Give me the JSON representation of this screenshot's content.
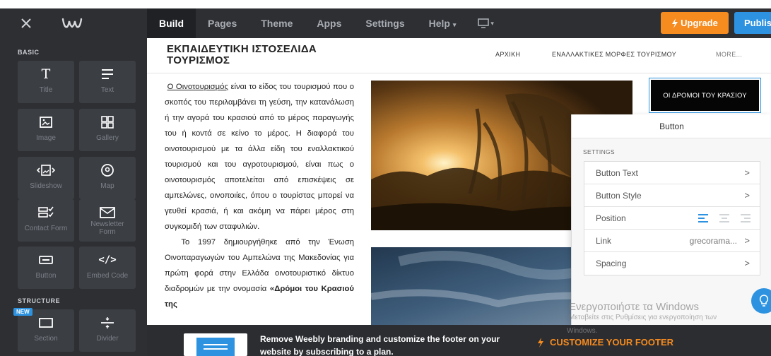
{
  "topbar": {
    "tabs": [
      "Build",
      "Pages",
      "Theme",
      "Apps",
      "Settings",
      "Help"
    ],
    "help_caret": "▾",
    "device_caret": "▾",
    "upgrade_label": "Upgrade",
    "publish_label": "Publish",
    "accent_orange": "#f68b1f",
    "accent_blue": "#2d93e1"
  },
  "sidebar": {
    "basic_heading": "BASIC",
    "structure_heading": "STRUCTURE",
    "new_badge": "NEW",
    "basic_items": [
      "Title",
      "Text",
      "Image",
      "Gallery",
      "Slideshow",
      "Map",
      "Contact Form",
      "Newsletter Form",
      "Button",
      "Embed Code"
    ],
    "newsletter_line1": "Newsletter",
    "newsletter_line2": "Form",
    "embed_icon_glyph": "</>",
    "title_icon_glyph": "T",
    "structure_items": [
      "Section",
      "Divider"
    ]
  },
  "site": {
    "title_line1": "ΕΚΠΑΙΔΕΥΤΙΚΗ ΙΣΤΟΣΕΛΙΔΑ",
    "title_line2": "ΤΟΥΡΙΣΜΟΣ",
    "nav": [
      "ΑΡΧΙΚΗ",
      "ΕΝΑΛΛΑΚΤΙΚΕΣ ΜΟΡΦΕΣ ΤΟΥΡΙΣΜΟΥ",
      "MORE..."
    ]
  },
  "article": {
    "link_text": "Ο Οινοτουρισμός",
    "para1_rest": " είναι το είδος του τουρισμού που ο σκοπός του περιλαμβάνει τη γεύση, την κατανάλωση ή την αγορά του κρασιού από το μέρος παραγωγής του ή κοντά σε κείνο το μέρος. Η διαφορά του οινοτουρισμού με τα άλλα είδη του εναλλακτικού τουρισμού και του αγροτουρισμού, είναι πως ο οινοτουρισμός αποτελείται από επισκέψεις σε αμπελώνες, οινοποιίες, όπου ο τουρίστας μπορεί να γευθεί κρασιά, ή και ακόμη να πάρει μέρος στη συγκομιδή των σταφυλιών.",
    "para2": "Το 1997 δημιουργήθηκε από την Ένωση Οινοπαραγωγών του Αμπελώνα της Μακεδονίας για πρώτη φορά στην Ελλάδα οινοτουριστικό δίκτυο διαδρομών με την ονομασία",
    "para2_bold": "«Δρόμοι του Κρασιού της"
  },
  "button_element": {
    "label": "ΟΙ ΔΡΟΜΟΙ ΤΟΥ ΚΡΑΣΙΟΥ"
  },
  "panel": {
    "title": "Button",
    "caption": "SETTINGS",
    "rows": [
      "Button Text",
      "Button Style",
      "Position",
      "Link",
      "Spacing"
    ],
    "link_value": "grecorama...",
    "chevron": ">"
  },
  "watermark": {
    "line1": "Ενεργοποιήστε τα Windows",
    "line2": "Μεταβείτε στις Ρυθμίσεις για ενεργοποίηση των",
    "line3": "Windows."
  },
  "footer": {
    "message": "Remove Weebly branding and customize the footer on your website by subscribing to a plan.",
    "cta": "CUSTOMIZE YOUR FOOTER"
  }
}
